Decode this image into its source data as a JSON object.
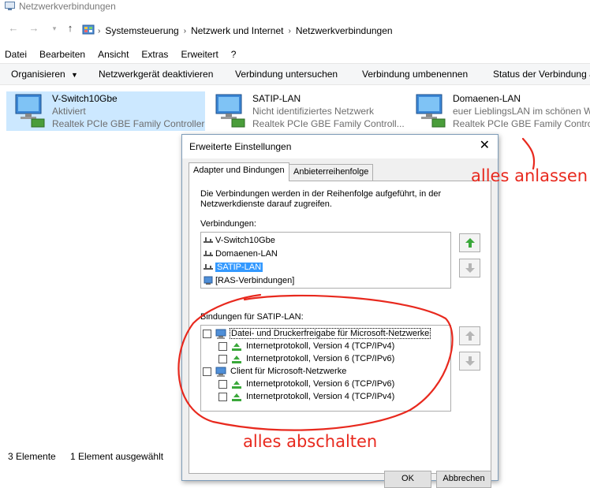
{
  "window": {
    "title": "Netzwerkverbindungen"
  },
  "address": {
    "breadcrumbs": [
      "Systemsteuerung",
      "Netzwerk und Internet",
      "Netzwerkverbindungen"
    ]
  },
  "menu": [
    "Datei",
    "Bearbeiten",
    "Ansicht",
    "Extras",
    "Erweitert",
    "?"
  ],
  "commands": {
    "organize": "Organisieren",
    "disable": "Netzwerkgerät deaktivieren",
    "diagnose": "Verbindung untersuchen",
    "rename": "Verbindung umbenennen",
    "status": "Status der Verbindung a"
  },
  "connections": [
    {
      "name": "V-Switch10Gbe",
      "status": "Aktiviert",
      "device": "Realtek PCIe GBE Family Controller",
      "selected": true
    },
    {
      "name": "SATIP-LAN",
      "status": "Nicht identifiziertes Netzwerk",
      "device": "Realtek PCIe GBE Family Controll..."
    },
    {
      "name": "Domaenen-LAN",
      "status": "euer LieblingsLAN im schönen W",
      "device": "Realtek PCIe GBE Family Controll"
    }
  ],
  "statusbar": {
    "count": "3 Elemente",
    "selection": "1 Element ausgewählt"
  },
  "dialog": {
    "title": "Erweiterte Einstellungen",
    "close": "✕",
    "tabs": [
      "Adapter und Bindungen",
      "Anbieterreihenfolge"
    ],
    "description": "Die Verbindungen werden in der Reihenfolge aufgeführt, in der Netzwerkdienste darauf zugreifen.",
    "connections_label": "Verbindungen:",
    "connection_list": [
      "V-Switch10Gbe",
      "Domaenen-LAN",
      "SATIP-LAN",
      "[RAS-Verbindungen]"
    ],
    "bindings_label": "Bindungen für SATIP-LAN:",
    "bindings": [
      {
        "label": "Datei- und Druckerfreigabe für Microsoft-Netzwerke",
        "level": 0,
        "checked": false
      },
      {
        "label": "Internetprotokoll, Version 4 (TCP/IPv4)",
        "level": 1,
        "checked": false
      },
      {
        "label": "Internetprotokoll, Version 6 (TCP/IPv6)",
        "level": 1,
        "checked": false
      },
      {
        "label": "Client für Microsoft-Netzwerke",
        "level": 0,
        "checked": false
      },
      {
        "label": "Internetprotokoll, Version 6 (TCP/IPv6)",
        "level": 1,
        "checked": false
      },
      {
        "label": "Internetprotokoll, Version 4 (TCP/IPv4)",
        "level": 1,
        "checked": false
      }
    ],
    "ok_label": "OK",
    "cancel_label": "Abbrechen"
  },
  "annotations": {
    "top_right": "alles anlassen",
    "bottom": "alles abschalten"
  },
  "colors": {
    "annotation": "#e8291e",
    "selection": "#cce8ff",
    "list_selection": "#3399ff",
    "arrow_green": "#3aa83a"
  }
}
